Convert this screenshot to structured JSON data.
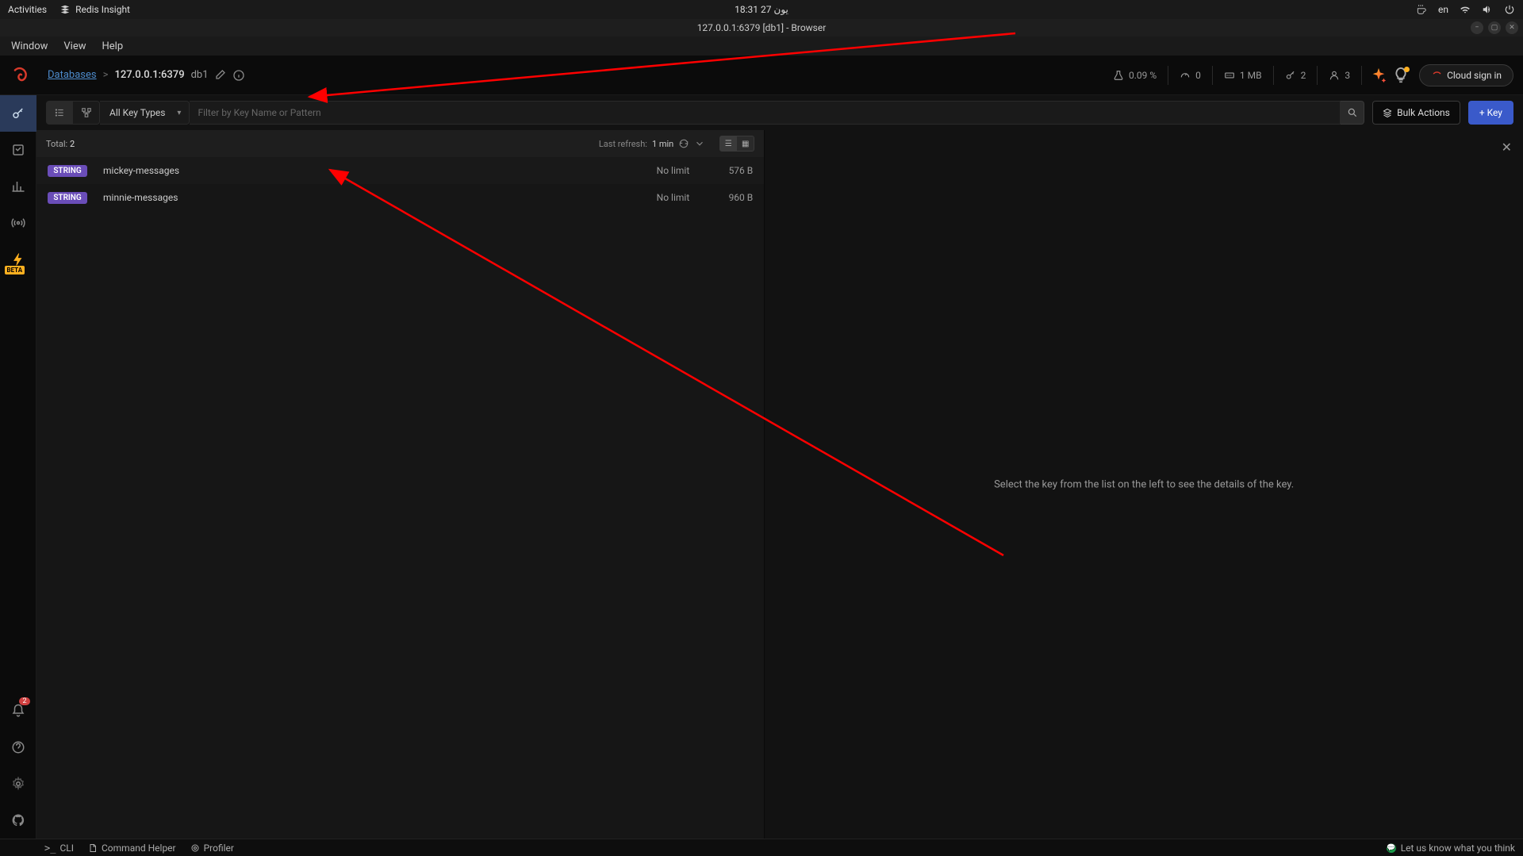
{
  "sysbar": {
    "activities": "Activities",
    "appname": "Redis Insight",
    "clock": "يون 27  18:31",
    "lang": "en"
  },
  "winbar": {
    "title": "127.0.0.1:6379 [db1] - Browser"
  },
  "menubar": {
    "window": "Window",
    "view": "View",
    "help": "Help"
  },
  "breadcrumb": {
    "databases": "Databases",
    "sep": ">",
    "host": "127.0.0.1:6379",
    "dbindex": "db1"
  },
  "stats": {
    "cpu": "0.09 %",
    "cmds": "0",
    "mem": "1 MB",
    "keys": "2",
    "clients": "3"
  },
  "cloud_btn": "Cloud sign in",
  "toolbar": {
    "keytype": "All Key Types",
    "filter_placeholder": "Filter by Key Name or Pattern",
    "bulk": "Bulk Actions",
    "addkey": "+ Key"
  },
  "list": {
    "total_label": "Total:",
    "total_value": "2",
    "refresh_label": "Last refresh:",
    "refresh_value": "1 min",
    "rows": [
      {
        "type": "STRING",
        "name": "mickey-messages",
        "ttl": "No limit",
        "size": "576 B"
      },
      {
        "type": "STRING",
        "name": "minnie-messages",
        "ttl": "No limit",
        "size": "960 B"
      }
    ]
  },
  "detail_placeholder": "Select the key from the list on the left to see the details of the key.",
  "sidebar": {
    "beta_badge": "BETA",
    "notif_count": "2"
  },
  "footer": {
    "cli": "CLI",
    "cmdhelper": "Command Helper",
    "profiler": "Profiler",
    "feedback": "Let us know what you think"
  }
}
